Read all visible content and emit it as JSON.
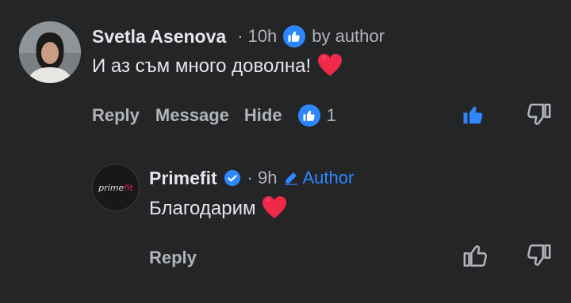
{
  "colors": {
    "background": "#242526",
    "accent": "#2d88ff",
    "heart": "#f02849",
    "muted": "#b0b3b8"
  },
  "comment": {
    "author": "Svetla Asenova",
    "separator": "·",
    "time": "10h",
    "liked_by_label": "by author",
    "text": "И аз съм много доволна!",
    "emoji": "heart-icon",
    "actions": {
      "reply": "Reply",
      "message": "Message",
      "hide": "Hide"
    },
    "reaction_count": "1"
  },
  "reply": {
    "author": "Primefit",
    "avatar_text_a": "prime",
    "avatar_text_b": "fit",
    "separator": "·",
    "time": "9h",
    "author_badge": "Author",
    "text": "Благодарим",
    "emoji": "heart-icon",
    "actions": {
      "reply": "Reply"
    }
  }
}
